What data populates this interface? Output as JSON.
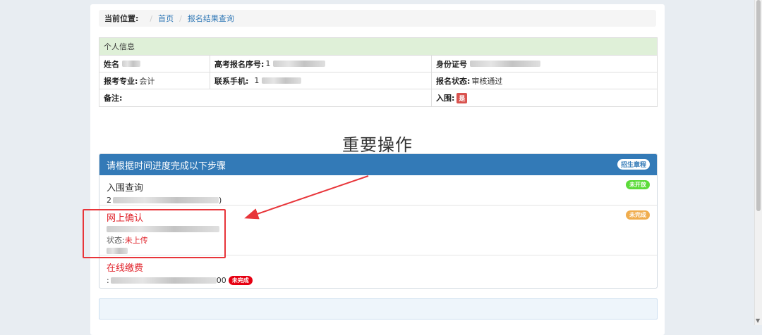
{
  "breadcrumb": {
    "label": "当前位置:",
    "separator": "/",
    "home": "首页",
    "current": "报名结果查询"
  },
  "info": {
    "header": "个人信息",
    "name_label": "姓名",
    "exam_no_label": "高考报名序号:",
    "exam_no_value_prefix": "1",
    "id_label": "身份证号",
    "major_label": "报考专业:",
    "major_value": "会计",
    "phone_label": "联系手机:",
    "phone_value_prefix": "1",
    "reg_status_label": "报名状态:",
    "reg_status_value": "审核通过",
    "remark_label": "备注:",
    "shortlist_label": "入围:",
    "shortlist_value": "是"
  },
  "main_title": "重要操作",
  "steps": {
    "header": "请根据时间进度完成以下步骤",
    "header_badge": "招生章程",
    "items": [
      {
        "title": "入围查询",
        "line_prefix": "2",
        "line_suffix": ")",
        "badge": "未开放"
      },
      {
        "title": "网上确认",
        "status_label": "状态:",
        "status_value": "未上传",
        "badge": "未完成"
      },
      {
        "title": "在线缴费",
        "line_prefix": ":",
        "line_suffix": "00",
        "badge": "未完成"
      }
    ]
  },
  "colors": {
    "primary": "#337ab7",
    "success_bg": "#dff0d8",
    "danger": "#e0232b",
    "highlight": "#e8353a"
  }
}
